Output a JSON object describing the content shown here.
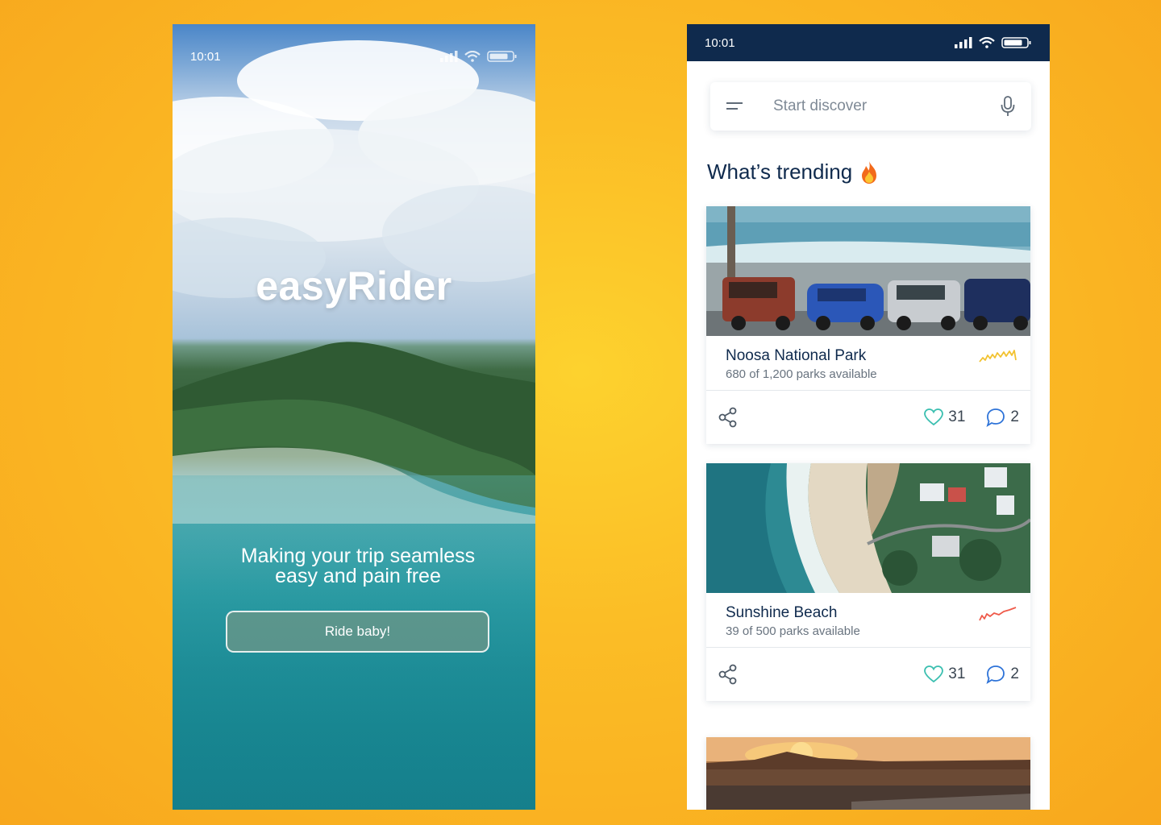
{
  "welcome_screen": {
    "status_time": "10:01",
    "brand": "easyRider",
    "tagline_line1": "Making your trip seamless",
    "tagline_line2": "easy and pain free",
    "cta_label": "Ride baby!"
  },
  "discover_screen": {
    "status_time": "10:01",
    "search": {
      "placeholder": "Start discover"
    },
    "section_title": "What’s trending",
    "section_icon": "fire-emoji",
    "cards": [
      {
        "title": "Noosa National Park",
        "subtitle": "680 of 1,200 parks available",
        "likes": "31",
        "comments": "2",
        "trend_color": "#f2c230"
      },
      {
        "title": "Sunshine Beach",
        "subtitle": "39 of 500 parks available",
        "likes": "31",
        "comments": "2",
        "trend_color": "#ef5a4a"
      }
    ]
  },
  "colors": {
    "background": "#fbbd26",
    "navy": "#0f2a4d",
    "heart": "#3bbfb0",
    "comment": "#2e73d8"
  }
}
